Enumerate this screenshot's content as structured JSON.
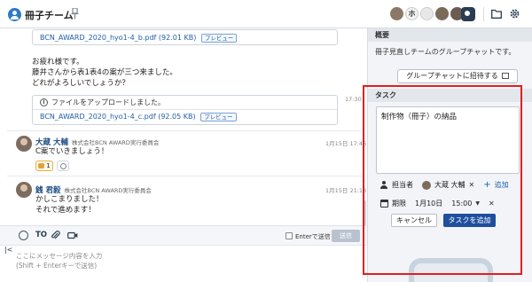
{
  "header": {
    "room_title": "冊子チーム",
    "member_initial": "ホ"
  },
  "timeline": {
    "file1": {
      "name": "BCN_AWARD_2020_hyo1-4_b.pdf",
      "size": "(92.01 KB)",
      "preview": "プレビュー"
    },
    "msg1_lines": [
      "お疲れ様です。",
      "藤井さんから表1表4の案が三つ来ました。",
      "どれがよろしいでしょうか？"
    ],
    "msg1_time": "17:30",
    "upload_notice": "ファイルをアップロードしました。",
    "file2": {
      "name": "BCN_AWARD_2020_hyo1-4_c.pdf",
      "size": "(92.05 KB)",
      "preview": "プレビュー"
    },
    "msg2": {
      "sender": "大蔵 大輔",
      "org": "株式会社BCN AWARD実行委員会",
      "time": "1月15日 17:46",
      "text": "C案でいきましょう！",
      "reaction_count": "1"
    },
    "msg3": {
      "sender": "銭 君毅",
      "org": "株式会社BCN AWARD実行委員会",
      "time": "1月15日 21:13",
      "lines": [
        "かしこまりました！",
        "それで進めます！"
      ]
    }
  },
  "toolbar": {
    "to_label": "TO",
    "enter_send": "Enterで送信",
    "send": "送信"
  },
  "composer": {
    "placeholder": "ここにメッセージ内容を入力\n(Shift + Enterキーで送信)"
  },
  "side": {
    "overview_title": "概要",
    "overview_text": "冊子見直しチームのグループチャットです。",
    "invite": "グループチャットに招待する",
    "task_title": "タスク",
    "task_text": "制作物（冊子）の納品",
    "assignee_label": "担当者",
    "assignee_name": "大蔵 大輔",
    "add_label": "追加",
    "due_label": "期限",
    "due_date": "1月10日",
    "due_time": "15:00",
    "cancel": "キャンセル",
    "add_task": "タスクを追加"
  },
  "colors": {
    "accent": "#1f4f9e",
    "link": "#1f5fa8",
    "highlight_frame": "#e02020"
  }
}
